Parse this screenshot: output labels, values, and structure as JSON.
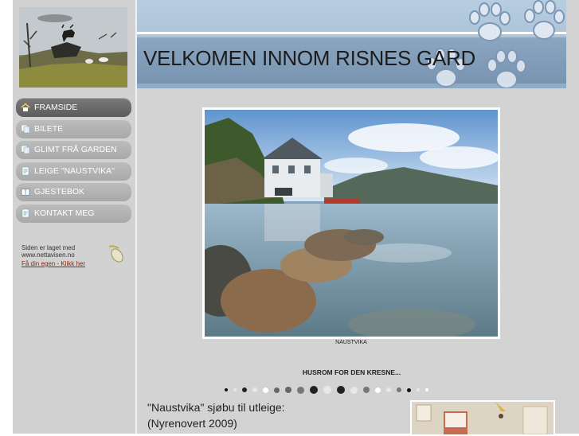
{
  "site": {
    "title": "VELKOMEN INNOM RISNES GARD"
  },
  "sidebar": {
    "items": [
      {
        "label": "FRAMSIDE",
        "icon": "home-icon",
        "active": true
      },
      {
        "label": "BILETE",
        "icon": "pages-icon",
        "active": false
      },
      {
        "label": "GLIMT FRÅ GARDEN",
        "icon": "pages-icon",
        "active": false
      },
      {
        "label": "LEIGE \"NAUSTVIKA\"",
        "icon": "document-icon",
        "active": false
      },
      {
        "label": "GJESTEBOK",
        "icon": "book-icon",
        "active": false
      },
      {
        "label": "KONTAKT MEG",
        "icon": "document-icon",
        "active": false
      }
    ],
    "badge": {
      "line1": "Siden er laget med",
      "line2": "www.nettavisen.no",
      "link": "Få din egen - Klikk her"
    }
  },
  "main": {
    "hero_caption": "NAUSTVIKA",
    "subtitle": "HUSROM FOR DEN KRESNE...",
    "slideshow_dots": 19,
    "intro_line1": "\"Naustvika\" sjøbu til utleige:",
    "intro_line2": "(Nyrenovert 2009)"
  },
  "colors": {
    "sidebar_bg": "#d2d2d2",
    "main_bg": "#d3d3d3",
    "header_blue": "#9fb8cf",
    "menu_active": "#666666",
    "menu_inactive": "#b0b0b0"
  }
}
